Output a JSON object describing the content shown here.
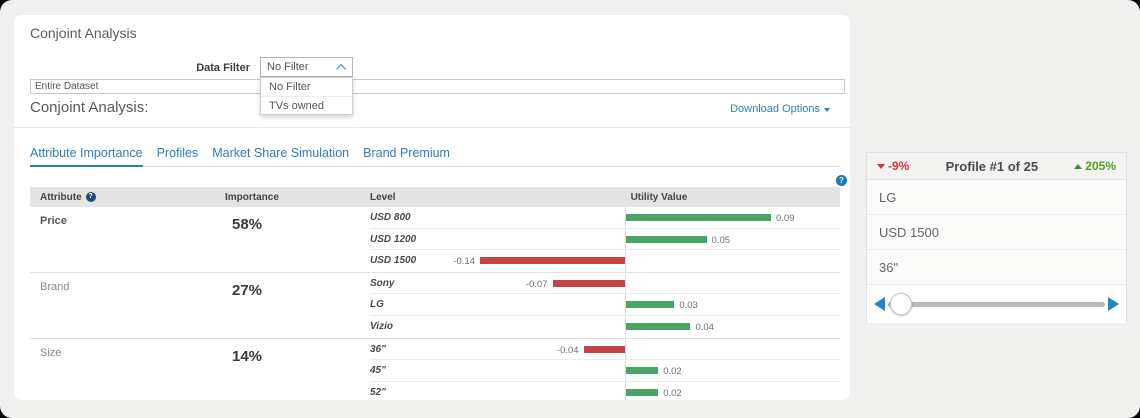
{
  "header": {
    "title": "Conjoint Analysis",
    "section_title": "Conjoint Analysis:",
    "download_label": "Download Options"
  },
  "filter": {
    "label": "Data Filter",
    "selected": "No Filter",
    "options": [
      "No Filter",
      "TVs owned"
    ]
  },
  "dataset": {
    "value": "Entire Dataset"
  },
  "tabs": [
    {
      "label": "Attribute Importance",
      "active": true
    },
    {
      "label": "Profiles",
      "active": false
    },
    {
      "label": "Market Share Simulation",
      "active": false
    },
    {
      "label": "Brand Premium",
      "active": false
    }
  ],
  "table": {
    "headers": {
      "attribute": "Attribute",
      "importance": "Importance",
      "level": "Level",
      "utility": "Utility Value"
    },
    "sections": [
      {
        "attribute": "Price",
        "importance": "58%",
        "emphasis": true,
        "levels": [
          {
            "label": "USD 800",
            "value": 0.09,
            "display": "0.09"
          },
          {
            "label": "USD 1200",
            "value": 0.05,
            "display": "0.05"
          },
          {
            "label": "USD 1500",
            "value": -0.14,
            "display": "-0.14"
          }
        ]
      },
      {
        "attribute": "Brand",
        "importance": "27%",
        "emphasis": false,
        "levels": [
          {
            "label": "Sony",
            "value": -0.07,
            "display": "-0.07"
          },
          {
            "label": "LG",
            "value": 0.03,
            "display": "0.03"
          },
          {
            "label": "Vizio",
            "value": 0.04,
            "display": "0.04"
          }
        ]
      },
      {
        "attribute": "Size",
        "importance": "14%",
        "emphasis": false,
        "levels": [
          {
            "label": "36\"",
            "value": -0.04,
            "display": "-0.04"
          },
          {
            "label": "45\"",
            "value": 0.02,
            "display": "0.02"
          },
          {
            "label": "52\"",
            "value": 0.02,
            "display": "0.02"
          }
        ]
      }
    ]
  },
  "profile": {
    "decrease": "-9%",
    "title": "Profile #1 of 25",
    "increase": "205%",
    "attributes": [
      "LG",
      "USD 1500",
      "36\""
    ]
  },
  "colors": {
    "positive_bar": "#4aa564",
    "negative_bar": "#c64343",
    "accent_blue": "#2b7fc3",
    "increase_text": "#4ea224",
    "decrease_text": "#c23b34"
  }
}
